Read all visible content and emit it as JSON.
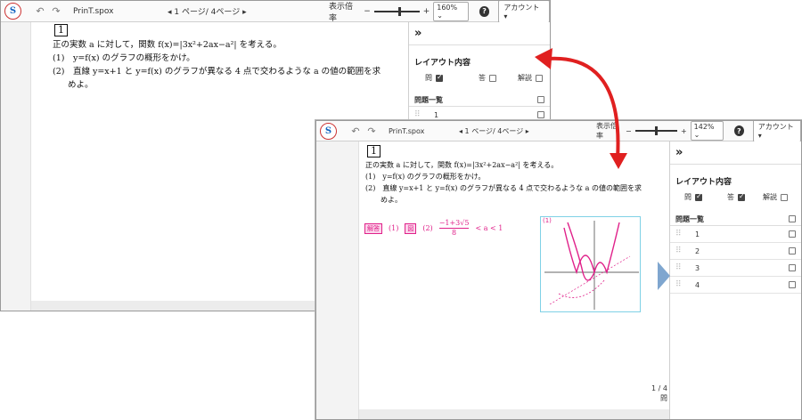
{
  "app": {
    "logo_text": "S",
    "file_name": "PrinT.spox"
  },
  "toolbar": {
    "undo_icon": "undo-icon",
    "redo_icon": "redo-icon",
    "pager_back": "◂ 1 ページ/ 4ページ ▸",
    "pager_front": "◂ 1 ページ/ 4ページ ▸",
    "zoom_label": "表示倍率",
    "zoom_minus": "−",
    "zoom_plus": "+",
    "zoom_back": "160% ⌄",
    "zoom_front": "142% ⌄",
    "help": "?",
    "account": "アカウント ▾"
  },
  "panel": {
    "collapse": "»",
    "layout_title": "レイアウト内容",
    "toggles": [
      {
        "label": "問",
        "checked": true
      },
      {
        "label": "答",
        "checked_back": false,
        "checked_front": true
      },
      {
        "label": "解説",
        "checked": false
      }
    ],
    "list_title": "問題一覧",
    "items": [
      "1",
      "2",
      "3",
      "4"
    ]
  },
  "problem": {
    "number": "1",
    "line1": "正の実数 a に対して，関数 f(x)=|3x²+2ax−a²| を考える。",
    "line2": "(1)　y=f(x) のグラフの概形をかけ。",
    "line3": "(2)　直線 y=x+1 と y=f(x) のグラフが異なる 4 点で交わるような a の値の範囲を求",
    "line3b": "めよ。"
  },
  "answer": {
    "tag": "解答",
    "part1": "(1)",
    "figref": "図",
    "part2": "(2)",
    "frac_num": "−1+3√5",
    "frac_den": "8",
    "tail": "< a < 1",
    "graph_label": "(1)"
  },
  "page_info": {
    "page": "1 / 4",
    "kind": "問"
  },
  "colors": {
    "accent": "#e0218a",
    "arrow": "#e02020",
    "next_arrow": "#7fa6cf"
  }
}
